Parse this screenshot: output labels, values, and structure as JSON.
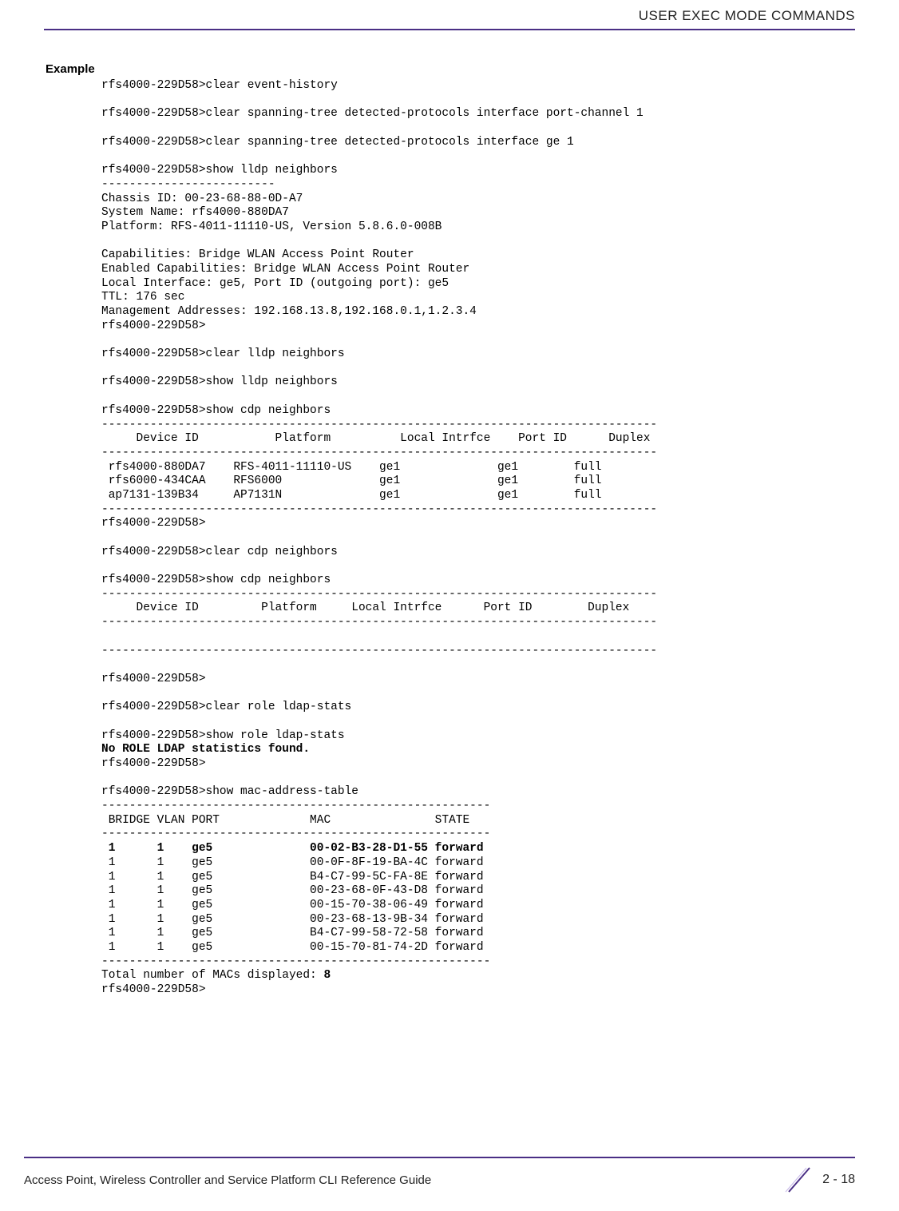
{
  "header": {
    "section": "USER EXEC MODE COMMANDS"
  },
  "example": {
    "label": "Example",
    "body_pre_bold": "rfs4000-229D58>clear event-history\n\nrfs4000-229D58>clear spanning-tree detected-protocols interface port-channel 1\n\nrfs4000-229D58>clear spanning-tree detected-protocols interface ge 1\n\nrfs4000-229D58>show lldp neighbors\n-------------------------\nChassis ID: 00-23-68-88-0D-A7\nSystem Name: rfs4000-880DA7\nPlatform: RFS-4011-11110-US, Version 5.8.6.0-008B\n\nCapabilities: Bridge WLAN Access Point Router\nEnabled Capabilities: Bridge WLAN Access Point Router\nLocal Interface: ge5, Port ID (outgoing port): ge5\nTTL: 176 sec\nManagement Addresses: 192.168.13.8,192.168.0.1,1.2.3.4\nrfs4000-229D58>\n\nrfs4000-229D58>clear lldp neighbors\n\nrfs4000-229D58>show lldp neighbors\n\nrfs4000-229D58>show cdp neighbors\n--------------------------------------------------------------------------------\n     Device ID           Platform          Local Intrfce    Port ID      Duplex\n--------------------------------------------------------------------------------\n rfs4000-880DA7    RFS-4011-11110-US    ge1              ge1        full\n rfs6000-434CAA    RFS6000              ge1              ge1        full\n ap7131-139B34     AP7131N              ge1              ge1        full\n--------------------------------------------------------------------------------\nrfs4000-229D58>\n\nrfs4000-229D58>clear cdp neighbors\n\nrfs4000-229D58>show cdp neighbors\n--------------------------------------------------------------------------------\n     Device ID         Platform     Local Intrfce      Port ID        Duplex\n--------------------------------------------------------------------------------\n\n--------------------------------------------------------------------------------\n\nrfs4000-229D58>\n\nrfs4000-229D58>clear role ldap-stats\n\nrfs4000-229D58>show role ldap-stats\n",
    "ldap_bold": "No ROLE LDAP statistics found.",
    "body_after_ldap": "\nrfs4000-229D58>\n\nrfs4000-229D58>show mac-address-table\n--------------------------------------------------------\n BRIDGE VLAN PORT             MAC               STATE\n--------------------------------------------------------\n",
    "mac_first_bold": " 1      1    ge5              00-02-B3-28-D1-55 forward",
    "body_after_first_mac": "\n 1      1    ge5              00-0F-8F-19-BA-4C forward\n 1      1    ge5              B4-C7-99-5C-FA-8E forward\n 1      1    ge5              00-23-68-0F-43-D8 forward\n 1      1    ge5              00-15-70-38-06-49 forward\n 1      1    ge5              00-23-68-13-9B-34 forward\n 1      1    ge5              B4-C7-99-58-72-58 forward\n 1      1    ge5              00-15-70-81-74-2D forward\n--------------------------------------------------------\nTotal number of MACs displayed: ",
    "total_bold": "8",
    "body_tail": "\nrfs4000-229D58>"
  },
  "footer": {
    "title": "Access Point, Wireless Controller and Service Platform CLI Reference Guide",
    "page": "2 - 18"
  }
}
